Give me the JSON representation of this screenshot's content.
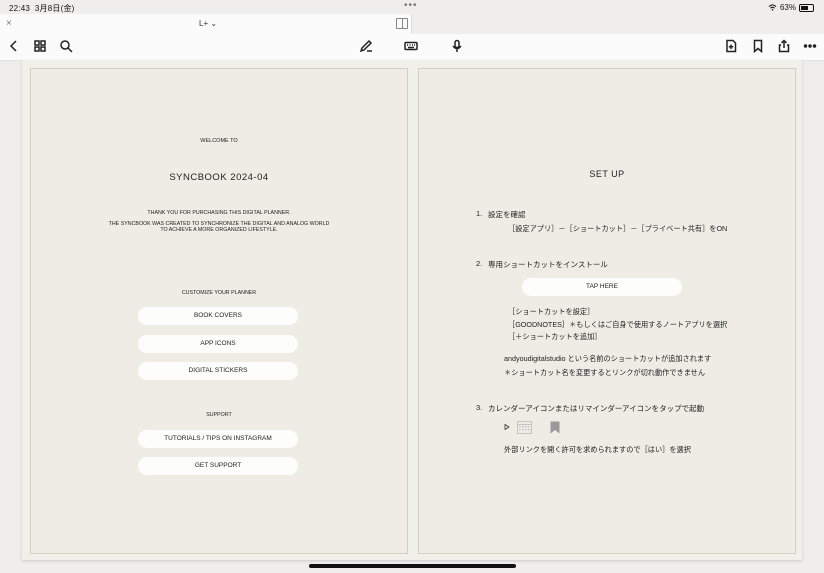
{
  "status": {
    "time": "22:43",
    "date": "3月8日(金)",
    "dots": "•••",
    "battery_pct": "63%"
  },
  "tab": {
    "title": "L+",
    "close_glyph": "×",
    "chevron": "⌄"
  },
  "left": {
    "welcome": "WELCOME TO",
    "title": "SYNCBOOK  2024-04",
    "thanks": "THANK YOU FOR PURCHASING THIS DIGITAL PLANNER.",
    "desc1": "THE SYNCBOOK WAS CREATED TO SYNCHRONIZE THE DIGITAL AND ANALOG WORLD",
    "desc2": "TO ACHIEVE A MORE ORGANIZED LIFESTYLE.",
    "customize_heading": "CUSTOMIZE YOUR PLANNER",
    "buttons": [
      "BOOK COVERS",
      "APP ICONS",
      "DIGITAL STICKERS"
    ],
    "support_heading": "SUPPORT",
    "support_buttons": [
      "TUTORIALS / TIPS ON INSTAGRAM",
      "GET SUPPORT"
    ]
  },
  "right": {
    "title": "SET UP",
    "step1_num": "1.",
    "step1": "設定を確認",
    "step1_detail": "［設定アプリ］－［ショートカット］－［プライベート共有］をON",
    "step2_num": "2.",
    "step2": "専用ショートカットをインストール",
    "tap_here": "TAP HERE",
    "step2_line1": "［ショートカットを設定］",
    "step2_line2": "［GOODNOTES］＊もしくはご自身で使用するノートアプリを選択",
    "step2_line3": "［＋ショートカットを追加］",
    "step2_line4": "andyoudigitalstudio という名前のショートカットが追加されます",
    "step2_line5": "＊ショートカット名を変更するとリンクが切れ動作できません",
    "step3_num": "3.",
    "step3": "カレンダーアイコンまたはリマインダーアイコンをタップで起動",
    "step3_detail": "外部リンクを開く許可を求められますので［はい］を選択"
  }
}
